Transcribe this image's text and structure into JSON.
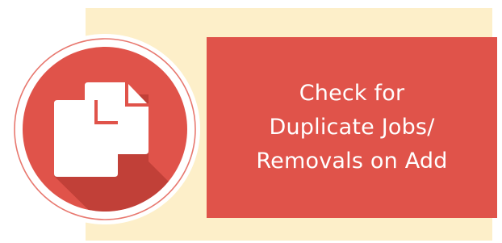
{
  "colors": {
    "accent_red": "#e0534a",
    "cream": "#fdefc9",
    "shadow_red": "#b73a33",
    "ring": "#e8786f",
    "icon_white": "#ffffff"
  },
  "badge": {
    "icon": "duplicate-documents-icon"
  },
  "callout": {
    "line1": "Check for",
    "line2": "Duplicate Jobs/",
    "line3": "Removals on Add"
  }
}
